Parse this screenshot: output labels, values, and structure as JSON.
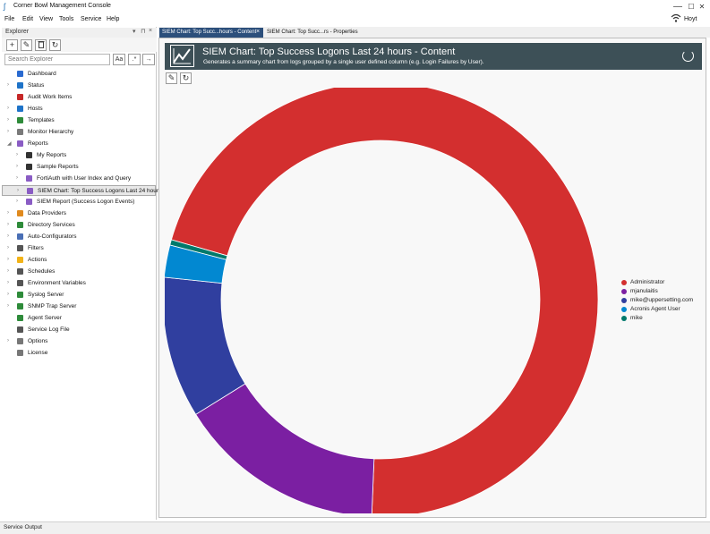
{
  "window": {
    "title": "Corner Bowl Management Console",
    "minimize": "—",
    "maximize": "☐",
    "close": "✕"
  },
  "menu": [
    "File",
    "Edit",
    "View",
    "Tools",
    "Service",
    "Help"
  ],
  "user": "Hoyt",
  "explorer": {
    "title": "Explorer",
    "header_icons": [
      "▾",
      "⊓",
      "×"
    ],
    "search_placeholder": "Search Explorer",
    "match_case_label": "Aa",
    "regex_label": ".*",
    "go_label": "→",
    "tree": [
      {
        "label": "Dashboard",
        "level": 0,
        "expander": "",
        "icon": "dashboard-icon",
        "color": "#2a6ad0"
      },
      {
        "label": "Status",
        "level": 0,
        "expander": "›",
        "icon": "info-icon",
        "color": "#1e73c8"
      },
      {
        "label": "Audit Work Items",
        "level": 0,
        "expander": "",
        "icon": "shield-icon",
        "color": "#c62828"
      },
      {
        "label": "Hosts",
        "level": 0,
        "expander": "›",
        "icon": "server-icon",
        "color": "#1e73c8"
      },
      {
        "label": "Templates",
        "level": 0,
        "expander": "›",
        "icon": "template-icon",
        "color": "#2e8b3a"
      },
      {
        "label": "Monitor Hierarchy",
        "level": 0,
        "expander": "›",
        "icon": "hierarchy-icon",
        "color": "#7a7a7a"
      },
      {
        "label": "Reports",
        "level": 0,
        "expander": "◢",
        "icon": "reports-icon",
        "color": "#8a5cc4"
      },
      {
        "label": "My Reports",
        "level": 1,
        "expander": "›",
        "icon": "folder-icon",
        "color": "#333333"
      },
      {
        "label": "Sample Reports",
        "level": 1,
        "expander": "›",
        "icon": "folder-icon",
        "color": "#333333"
      },
      {
        "label": "FortiAuth with User Index and Query",
        "level": 1,
        "expander": "›",
        "icon": "report-icon",
        "color": "#8a5cc4"
      },
      {
        "label": "SIEM Chart: Top Success  Logons Last 24 hours",
        "level": 1,
        "expander": "›",
        "icon": "report-icon",
        "color": "#8a5cc4",
        "selected": true
      },
      {
        "label": "SIEM Report (Success Logon Events)",
        "level": 1,
        "expander": "›",
        "icon": "report-icon",
        "color": "#8a5cc4"
      },
      {
        "label": "Data Providers",
        "level": 0,
        "expander": "›",
        "icon": "data-providers-icon",
        "color": "#e08a1e"
      },
      {
        "label": "Directory Services",
        "level": 0,
        "expander": "›",
        "icon": "tree-icon",
        "color": "#2e8b3a"
      },
      {
        "label": "Auto-Configurators",
        "level": 0,
        "expander": "›",
        "icon": "wand-icon",
        "color": "#4a6fb5"
      },
      {
        "label": "Filters",
        "level": 0,
        "expander": "›",
        "icon": "filter-icon",
        "color": "#555555"
      },
      {
        "label": "Actions",
        "level": 0,
        "expander": "›",
        "icon": "warning-icon",
        "color": "#f2b318"
      },
      {
        "label": "Schedules",
        "level": 0,
        "expander": "›",
        "icon": "clock-icon",
        "color": "#555555"
      },
      {
        "label": "Environment Variables",
        "level": 0,
        "expander": "›",
        "icon": "variables-icon",
        "color": "#555555"
      },
      {
        "label": "Syslog Server",
        "level": 0,
        "expander": "›",
        "icon": "syslog-icon",
        "color": "#2e8b3a"
      },
      {
        "label": "SNMP Trap Server",
        "level": 0,
        "expander": "›",
        "icon": "snmp-icon",
        "color": "#2e8b3a"
      },
      {
        "label": "Agent Server",
        "level": 0,
        "expander": "",
        "icon": "agent-icon",
        "color": "#2e8b3a"
      },
      {
        "label": "Service Log File",
        "level": 0,
        "expander": "",
        "icon": "log-file-icon",
        "color": "#555555"
      },
      {
        "label": "Options",
        "level": 0,
        "expander": "›",
        "icon": "gear-icon",
        "color": "#777777"
      },
      {
        "label": "License",
        "level": 0,
        "expander": "",
        "icon": "key-icon",
        "color": "#777777"
      }
    ]
  },
  "tabs": [
    {
      "label": "SIEM Chart: Top Succ...hours - Content",
      "close": "×"
    },
    {
      "label": "SIEM Chart: Top Succ...rs - Properties"
    }
  ],
  "banner": {
    "title": "SIEM Chart: Top Success  Logons Last 24 hours - Content",
    "subtitle": "Generates a summary chart from logs grouped by a single user defined column (e.g. Login Failures by User)."
  },
  "content_toolbar": {
    "edit": "✎",
    "refresh": "↻"
  },
  "chart_data": {
    "type": "pie",
    "style": "donut",
    "legend_position": "right",
    "series": [
      {
        "name": "Administrator",
        "value": 71.2,
        "color": "#d32f2f"
      },
      {
        "name": "mjanulaitis",
        "value": 15.5,
        "color": "#7b1fa2"
      },
      {
        "name": "mike@uppersetting.com",
        "value": 10.5,
        "color": "#303f9f"
      },
      {
        "name": "Acronis Agent User",
        "value": 2.4,
        "color": "#0288d1"
      },
      {
        "name": "mike",
        "value": 0.4,
        "color": "#00796b"
      }
    ]
  },
  "status": {
    "text": "Service Output"
  }
}
